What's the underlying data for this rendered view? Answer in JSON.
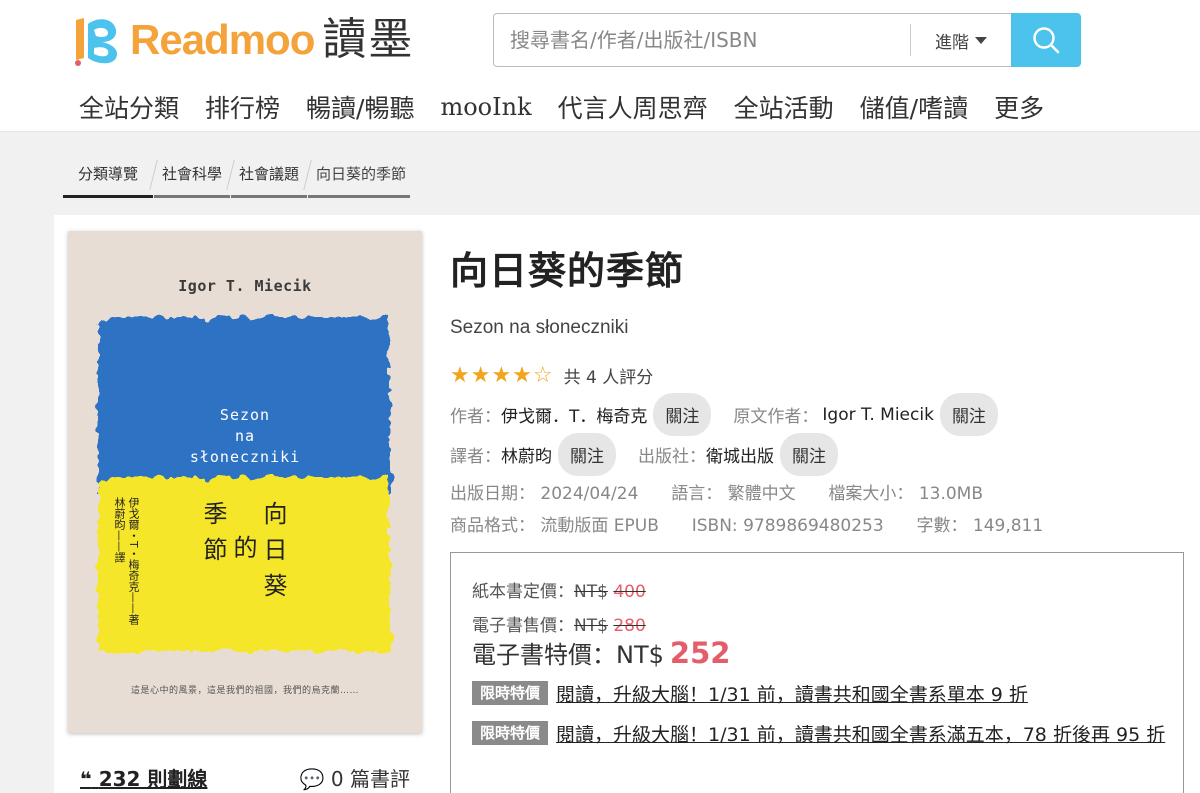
{
  "header": {
    "logo_text": "Readmoo",
    "logo_zh": "讀墨",
    "search": {
      "placeholder": "搜尋書名/作者/出版社/ISBN",
      "advanced_label": "進階"
    },
    "nav": [
      "全站分類",
      "排行榜",
      "暢讀/暢聽",
      "mooInk",
      "代言人周思齊",
      "全站活動",
      "儲值/嗜讀",
      "更多"
    ]
  },
  "breadcrumb": [
    "分類導覽",
    "社會科學",
    "社會議題",
    "向日葵的季節"
  ],
  "cover": {
    "author": "Igor T. Miecik",
    "title_pl": "Sezon\nna\nsłoneczniki",
    "title_zh_col1": "向日葵",
    "title_zh_col2": "的",
    "title_zh_col3": "季節",
    "author_zh": "伊戈爾・T・梅奇克——著\n林蔚昀——譯",
    "tagline": "這是心中的風景，這是我們的祖國，我們的烏克蘭……"
  },
  "stats": {
    "highlights": "232 則劃線",
    "reviews": "0 篇書評"
  },
  "book": {
    "title": "向日葵的季節",
    "subtitle": "Sezon na słoneczniki",
    "stars": "★★★★☆",
    "rating_count": "共 4 人評分",
    "author_label": "作者：",
    "author": "伊戈爾．T．梅奇克",
    "original_author_label": "原文作者：",
    "original_author": "Igor T. Miecik",
    "translator_label": "譯者：",
    "translator": "林蔚昀",
    "publisher_label": "出版社：",
    "publisher": "衛城出版",
    "follow_label": "關注",
    "pubdate_label": "出版日期：",
    "pubdate": "2024/04/24",
    "language_label": "語言：",
    "language": "繁體中文",
    "filesize_label": "檔案大小：",
    "filesize": "13.0MB",
    "format_label": "商品格式：",
    "format": "流動版面 EPUB",
    "isbn_label": "ISBN:",
    "isbn": "9789869480253",
    "words_label": "字數：",
    "words": "149,811"
  },
  "pricing": {
    "paper_label": "紙本書定價：",
    "paper_currency": "NT$",
    "paper_price": "400",
    "ebook_label": "電子書售價：",
    "ebook_currency": "NT$",
    "ebook_price": "280",
    "special_label": "電子書特價：NT$",
    "special_price": "252",
    "promo_tag": "限時特價",
    "promos": [
      "閱讀，升級大腦！1/31 前，讀書共和國全書系單本 9 折",
      "閱讀，升級大腦！1/31 前，讀書共和國全書系滿五本，78 折後再 95 折"
    ]
  },
  "colors": {
    "accent_orange": "#f4a23a",
    "search_blue": "#4cc3ec",
    "price_red": "#e35d6a",
    "star": "#f1a51d"
  }
}
